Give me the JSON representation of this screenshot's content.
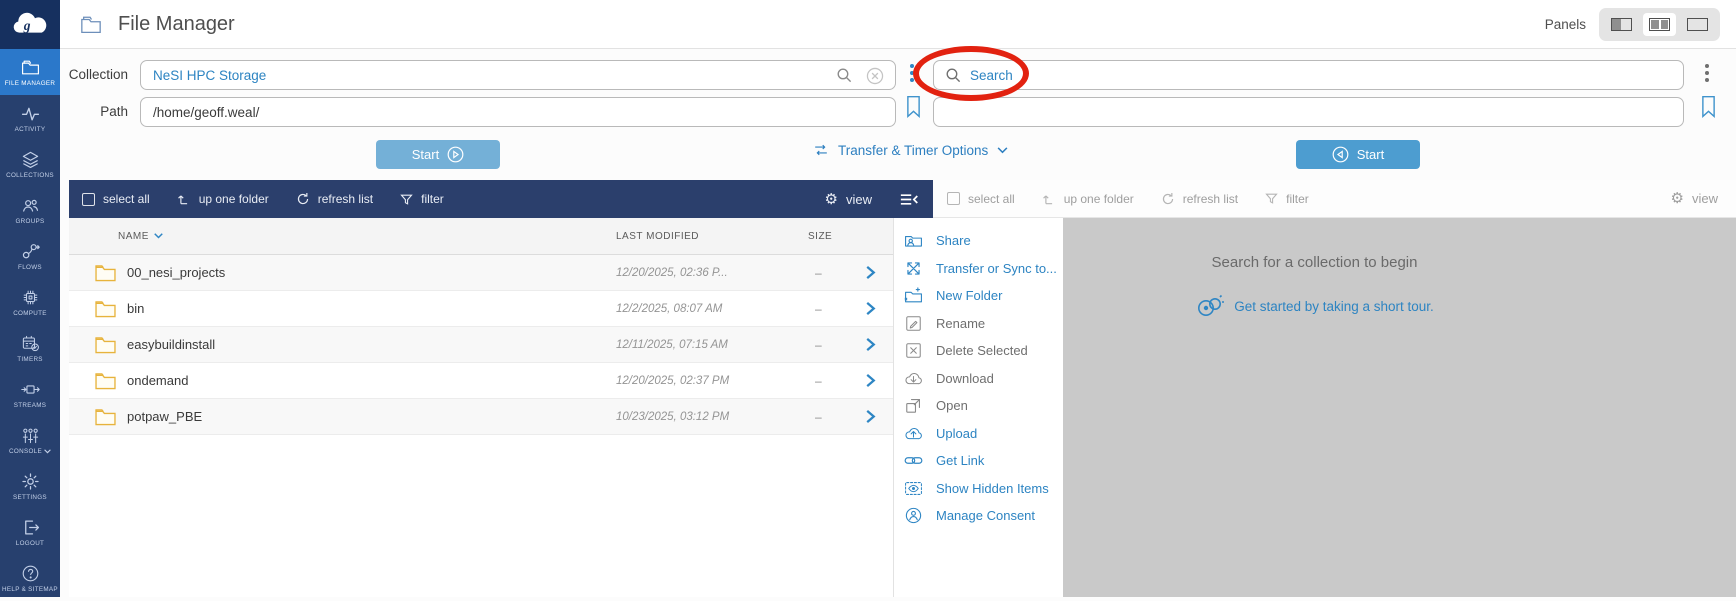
{
  "app": {
    "title": "File Manager",
    "panels_label": "Panels"
  },
  "sidebar": {
    "items": [
      {
        "label": "FILE MANAGER",
        "icon": "folder",
        "active": true,
        "chevron": false
      },
      {
        "label": "ACTIVITY",
        "icon": "activity",
        "active": false,
        "chevron": false
      },
      {
        "label": "COLLECTIONS",
        "icon": "collections",
        "active": false,
        "chevron": false
      },
      {
        "label": "GROUPS",
        "icon": "groups",
        "active": false,
        "chevron": false
      },
      {
        "label": "FLOWS",
        "icon": "flows",
        "active": false,
        "chevron": false
      },
      {
        "label": "COMPUTE",
        "icon": "compute",
        "active": false,
        "chevron": false
      },
      {
        "label": "TIMERS",
        "icon": "timers",
        "active": false,
        "chevron": false
      },
      {
        "label": "STREAMS",
        "icon": "streams",
        "active": false,
        "chevron": false
      },
      {
        "label": "CONSOLE",
        "icon": "console",
        "active": false,
        "chevron": true
      },
      {
        "label": "SETTINGS",
        "icon": "settings",
        "active": false,
        "chevron": false
      },
      {
        "label": "LOGOUT",
        "icon": "logout",
        "active": false,
        "chevron": false
      },
      {
        "label": "HELP & SITEMAP",
        "icon": "help",
        "active": false,
        "chevron": false
      }
    ]
  },
  "io": {
    "collection_label": "Collection",
    "collection_value": "NeSI HPC Storage",
    "path_label": "Path",
    "path_value": "/home/geoff.weal/",
    "search_placeholder": "Search"
  },
  "actions": {
    "start_label": "Start",
    "transfer_options_label": "Transfer & Timer Options"
  },
  "toolbar": {
    "select_all": "select all",
    "up_one_folder": "up one folder",
    "refresh_list": "refresh list",
    "filter": "filter",
    "view": "view"
  },
  "left_table": {
    "columns": [
      "NAME",
      "LAST MODIFIED",
      "SIZE"
    ],
    "rows": [
      {
        "name": "00_nesi_projects",
        "modified": "12/20/2025, 02:36 P...",
        "size": "–"
      },
      {
        "name": "bin",
        "modified": "12/2/2025, 08:07 AM",
        "size": "–"
      },
      {
        "name": "easybuildinstall",
        "modified": "12/11/2025, 07:15 AM",
        "size": "–"
      },
      {
        "name": "ondemand",
        "modified": "12/20/2025, 02:37 PM",
        "size": "–"
      },
      {
        "name": "potpaw_PBE",
        "modified": "10/23/2025, 03:12 PM",
        "size": "–"
      }
    ]
  },
  "context_menu": {
    "items": [
      {
        "label": "Share",
        "icon": "share",
        "enabled": true
      },
      {
        "label": "Transfer or Sync to...",
        "icon": "transfer",
        "enabled": true
      },
      {
        "label": "New Folder",
        "icon": "newfolder",
        "enabled": true
      },
      {
        "label": "Rename",
        "icon": "rename",
        "enabled": false
      },
      {
        "label": "Delete Selected",
        "icon": "delete",
        "enabled": false
      },
      {
        "label": "Download",
        "icon": "download",
        "enabled": false
      },
      {
        "label": "Open",
        "icon": "open",
        "enabled": false
      },
      {
        "label": "Upload",
        "icon": "upload",
        "enabled": true
      },
      {
        "label": "Get Link",
        "icon": "link",
        "enabled": true
      },
      {
        "label": "Show Hidden Items",
        "icon": "eye",
        "enabled": true
      },
      {
        "label": "Manage Consent",
        "icon": "consent",
        "enabled": true
      }
    ]
  },
  "right_panel": {
    "empty_line1": "Search for a collection to begin",
    "empty_line2": "Get started by taking a short tour."
  },
  "colors": {
    "sidebar_navy": "#27406e",
    "logo_navy": "#16305f",
    "active_item_blue": "#2b78ca",
    "toolbar_navy": "#2b3f6c",
    "accent_blue": "#2d84c2",
    "start_button_blue": "#4d9dd0",
    "folder_yellow": "#e7b33c",
    "panel_gray": "#c9c9c9",
    "annotation_red": "#e22210"
  }
}
